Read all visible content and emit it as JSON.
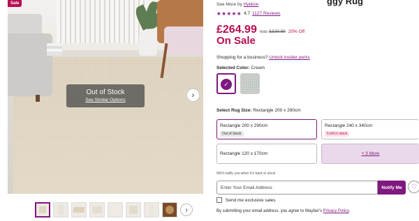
{
  "gallery": {
    "sale_badge": "Sale",
    "out_of_stock_title": "Out of Stock",
    "see_similar_link": "See Similar Options",
    "next_arrow": "›",
    "thumb_next_arrow": "›",
    "thumbnail_count": 8,
    "active_thumbnail": 1
  },
  "product": {
    "title_fragment": "ggy Rug",
    "see_more_prefix": "See More by",
    "brand": "Hykkon",
    "stars": "★★★★★",
    "rating": "4.7",
    "reviews": "1127 Reviews",
    "price": "£264.99",
    "was_label": "was",
    "was_price": "£329.99",
    "discount": "20% Off",
    "on_sale": "On Sale"
  },
  "business": {
    "text": "Shopping for a business?",
    "link": "Unlock insider perks"
  },
  "color": {
    "label": "Selected Color:",
    "value": "Cream",
    "check_glyph": "✓"
  },
  "rug_size": {
    "label": "Select Rug Size:",
    "value": "Rectangle 200 x 290cm",
    "options": [
      {
        "label": "Rectangle 200 x 290cm",
        "note": "Out of Stock"
      },
      {
        "label": "Rectangle 240 x 340cm",
        "note": "5 left in stock"
      },
      {
        "label": "Rectangle 120 x 170cm",
        "note": ""
      }
    ],
    "more": "+ 3 More"
  },
  "notify": {
    "hint": "We'll notify you when it's back in stock",
    "email_placeholder": "Enter Your Email Address",
    "button": "Notify Me",
    "heart_glyph": "♡",
    "exclusive_label": "Send me exclusive sales",
    "privacy_text": "By submitting your email address, you agree to Wayfair's",
    "privacy_link": "Privacy Policy",
    "privacy_end": "."
  },
  "colors": {
    "accent": "#7f187f",
    "sale": "#b50d52"
  }
}
